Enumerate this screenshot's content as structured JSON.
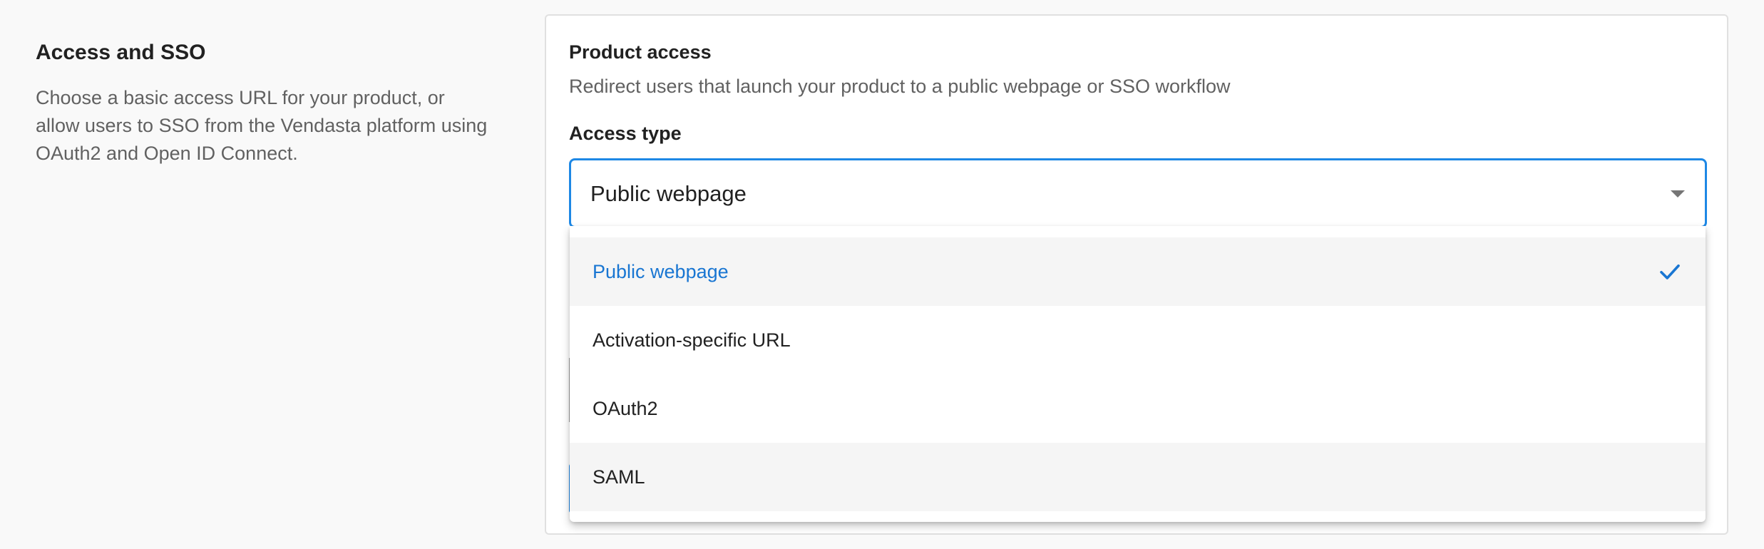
{
  "left": {
    "title": "Access and SSO",
    "description": "Choose a basic access URL for your product, or allow users to SSO from the Vendasta platform using OAuth2 and Open ID Connect."
  },
  "card": {
    "title": "Product access",
    "subtitle": "Redirect users that launch your product to a public webpage or SSO workflow",
    "access_type_label": "Access type",
    "selected_value": "Public webpage"
  },
  "dropdown": {
    "options": [
      {
        "label": "Public webpage",
        "selected": true
      },
      {
        "label": "Activation-specific URL",
        "selected": false
      },
      {
        "label": "OAuth2",
        "selected": false
      },
      {
        "label": "SAML",
        "selected": false
      }
    ]
  },
  "colors": {
    "accent": "#1e88e5",
    "selected_text": "#1976d2",
    "page_bg": "#f9f9f9"
  },
  "icons": {
    "dropdown_arrow": "caret-down-icon",
    "selected_check": "check-icon"
  }
}
